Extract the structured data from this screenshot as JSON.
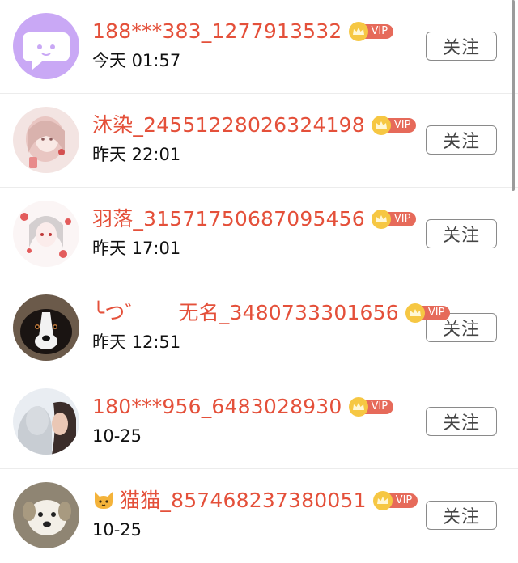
{
  "follow_label": "关注",
  "vip_label": "VIP",
  "colors": {
    "name": "#e4503a",
    "vip_tag": "#e66a5a",
    "crown": "#f6c743"
  },
  "users": [
    {
      "name": "188***383_1277913532",
      "time": "今天 01:57",
      "avatar": "purple-chat-bubble"
    },
    {
      "name": "沐染_24551228026324198",
      "time": "昨天 22:01",
      "avatar": "anime-girl-pink"
    },
    {
      "name": "羽落_31571750687095456",
      "time": "昨天 17:01",
      "avatar": "anime-girl-red-flowers"
    },
    {
      "name": "╰つ゛     无名_3480733301656",
      "time": "昨天 12:51",
      "avatar": "bernese-dog"
    },
    {
      "name": "180***956_6483028930",
      "time": "10-25",
      "avatar": "statue-and-woman"
    },
    {
      "name": "猫猫_857468237380051",
      "time": "10-25",
      "avatar": "white-puppy",
      "emoji": "cat-face-icon"
    }
  ]
}
